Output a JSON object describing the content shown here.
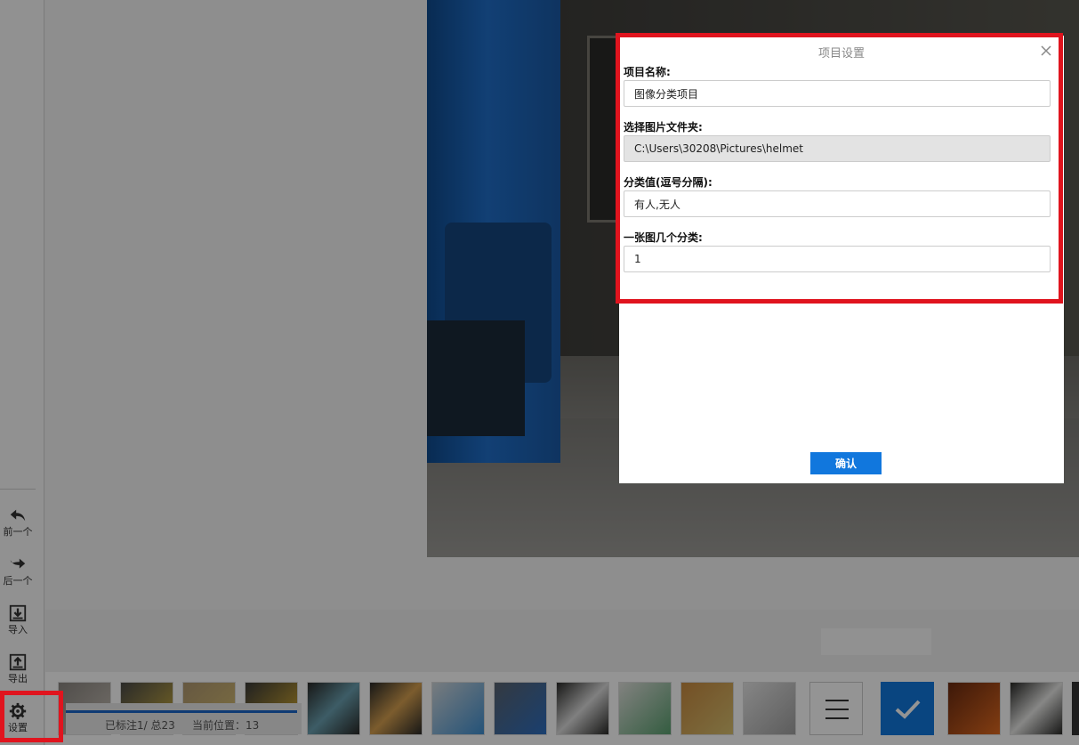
{
  "sidebar": {
    "items": [
      {
        "label": "前一个",
        "icon": "undo-arrow-icon"
      },
      {
        "label": "后一个",
        "icon": "redo-arrow-icon"
      },
      {
        "label": "导入",
        "icon": "import-icon"
      },
      {
        "label": "导出",
        "icon": "export-icon"
      },
      {
        "label": "设置",
        "icon": "gear-icon"
      }
    ]
  },
  "status": {
    "labeled": "已标注1/ 总23",
    "position": "当前位置：13"
  },
  "dialog": {
    "title": "项目设置",
    "close_icon": "close-icon",
    "fields": [
      {
        "label": "项目名称:",
        "value": "图像分类项目"
      },
      {
        "label": "选择图片文件夹:",
        "value": "C:\\Users\\30208\\Pictures\\helmet"
      },
      {
        "label": "分类值(逗号分隔):",
        "value": "有人,无人"
      },
      {
        "label": "一张图几个分类:",
        "value": "1"
      }
    ],
    "confirm_label": "确认"
  },
  "colors": {
    "accent": "#1177dd",
    "highlight": "#e0141e"
  }
}
